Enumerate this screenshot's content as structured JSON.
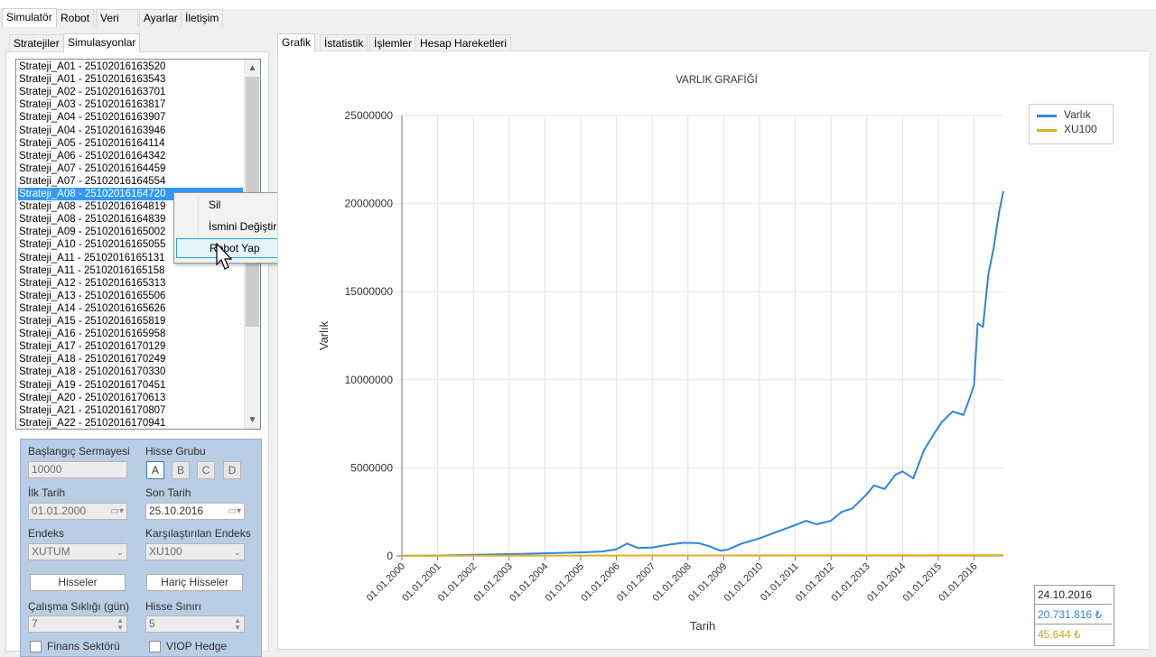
{
  "main_tabs": [
    "Simulatör",
    "Robot",
    "Veri",
    "Ayarlar",
    "İletişim"
  ],
  "left_tabs": [
    "Stratejiler",
    "Simulasyonlar"
  ],
  "right_tabs": [
    "Grafik",
    "İstatistik",
    "İşlemler",
    "Hesap Hareketleri"
  ],
  "simulations": [
    "Strateji_A01 - 25102016163520",
    "Strateji_A01 - 25102016163543",
    "Strateji_A02 - 25102016163701",
    "Strateji_A03 - 25102016163817",
    "Strateji_A04 - 25102016163907",
    "Strateji_A04 - 25102016163946",
    "Strateji_A05 - 25102016164114",
    "Strateji_A06 - 25102016164342",
    "Strateji_A07 - 25102016164459",
    "Strateji_A07 - 25102016164554",
    "Strateji_A08 - 25102016164720",
    "Strateji_A08 - 25102016164819",
    "Strateji_A08 - 25102016164839",
    "Strateji_A09 - 25102016165002",
    "Strateji_A10 - 25102016165055",
    "Strateji_A11 - 25102016165131",
    "Strateji_A11 - 25102016165158",
    "Strateji_A12 - 25102016165313",
    "Strateji_A13 - 25102016165506",
    "Strateji_A14 - 25102016165626",
    "Strateji_A15 - 25102016165819",
    "Strateji_A16 - 25102016165958",
    "Strateji_A17 - 25102016170129",
    "Strateji_A18 - 25102016170249",
    "Strateji_A18 - 25102016170330",
    "Strateji_A19 - 25102016170451",
    "Strateji_A20 - 25102016170613",
    "Strateji_A21 - 25102016170807",
    "Strateji_A22 - 25102016170941"
  ],
  "selected_simulation": "Strateji_A08 - 25102016164720",
  "context_menu": {
    "delete": "Sil",
    "rename": "İsmini Değiştir",
    "make_robot": "Robot Yap"
  },
  "settings": {
    "capital_label": "Başlangıç Sermayesi",
    "capital_value": "10000",
    "group_label": "Hisse Grubu",
    "groups": [
      "A",
      "B",
      "C",
      "D"
    ],
    "start_label": "İlk Tarih",
    "start_value": "01.01.2000",
    "end_label": "Son Tarih",
    "end_value": "25.10.2016",
    "index_label": "Endeks",
    "index_value": "XUTUM",
    "compare_label": "Karşılaştırılan Endeks",
    "compare_value": "XU100",
    "stocks_button": "Hisseler",
    "excluded_button": "Hariç Hisseler",
    "frequency_label": "Çalışma Sıklığı (gün)",
    "frequency_value": "7",
    "limit_label": "Hisse Sınırı",
    "limit_value": "5",
    "finance_label": "Finans Sektörü",
    "viop_label": "VIOP Hedge"
  },
  "info_box": {
    "date": "24.10.2016",
    "asset": "20.731.816 ₺",
    "index": "45.644 ₺"
  },
  "colors": {
    "asset": "#2e86de",
    "index": "#e0b020",
    "selection": "#3399ff"
  },
  "chart_data": {
    "type": "line",
    "title": "VARLIK GRAFİĞİ",
    "xlabel": "Tarih",
    "ylabel": "Varlık",
    "ylim": [
      0,
      25000000
    ],
    "yticks": [
      "0",
      "5000000",
      "10000000",
      "15000000",
      "20000000",
      "25000000"
    ],
    "xticks": [
      "01.01.2000",
      "01.01.2001",
      "01.01.2002",
      "01.01.2003",
      "01.01.2004",
      "01.01.2005",
      "01.01.2006",
      "01.01.2007",
      "01.01.2008",
      "01.01.2009",
      "01.01.2010",
      "01.01.2011",
      "01.01.2012",
      "01.01.2013",
      "01.01.2014",
      "01.01.2015",
      "01.01.2016"
    ],
    "legend_position": "top-right",
    "grid": true,
    "series": [
      {
        "name": "Varlık",
        "x": [
          2000.0,
          2001.0,
          2002.0,
          2003.0,
          2004.0,
          2005.0,
          2005.6,
          2006.0,
          2006.3,
          2006.6,
          2007.0,
          2007.5,
          2007.9,
          2008.3,
          2008.6,
          2008.9,
          2009.1,
          2009.5,
          2010.0,
          2010.4,
          2011.0,
          2011.3,
          2011.6,
          2012.0,
          2012.3,
          2012.6,
          2013.0,
          2013.2,
          2013.5,
          2013.8,
          2014.0,
          2014.3,
          2014.6,
          2014.9,
          2015.1,
          2015.4,
          2015.7,
          2015.85,
          2016.0,
          2016.1,
          2016.25,
          2016.4,
          2016.55,
          2016.7,
          2016.82
        ],
        "y": [
          10000,
          20000,
          60000,
          100000,
          150000,
          200000,
          250000,
          380000,
          700000,
          450000,
          480000,
          650000,
          750000,
          720000,
          550000,
          300000,
          350000,
          700000,
          1000000,
          1300000,
          1750000,
          2000000,
          1800000,
          2000000,
          2500000,
          2700000,
          3500000,
          4000000,
          3800000,
          4600000,
          4800000,
          4400000,
          6000000,
          7000000,
          7600000,
          8200000,
          8000000,
          8800000,
          9700000,
          13200000,
          13000000,
          16000000,
          17500000,
          19500000,
          20700000
        ]
      },
      {
        "name": "XU100",
        "x": [
          2000.0,
          2016.82
        ],
        "y": [
          10000,
          45644
        ]
      }
    ]
  }
}
